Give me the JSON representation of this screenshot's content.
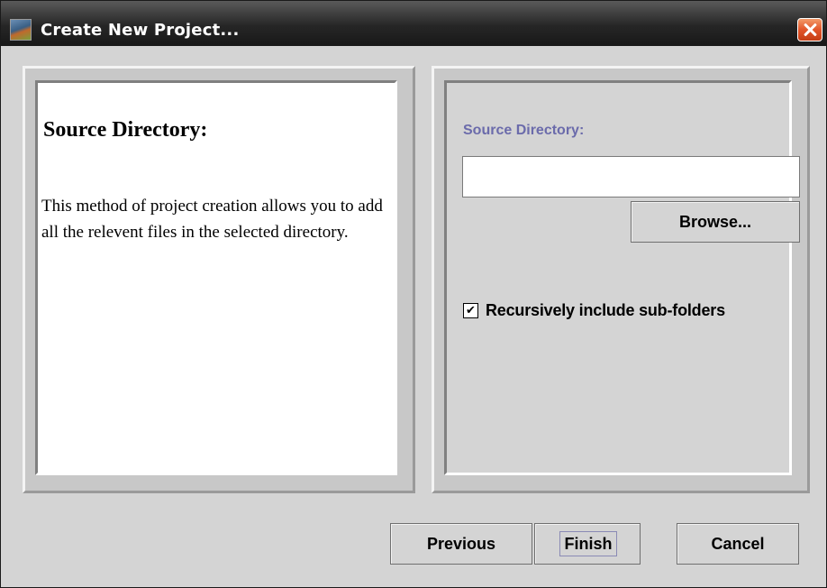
{
  "window": {
    "title": "Create New Project...",
    "app_icon": "app-icon",
    "close_icon": "close-icon"
  },
  "description": {
    "heading": "Source Directory:",
    "body": "This method of project creation allows you to add all the relevent files in the selected directory."
  },
  "form": {
    "source_label": "Source Directory:",
    "source_value": "",
    "browse_label": "Browse...",
    "recursive_checked": true,
    "recursive_mark": "✔",
    "recursive_label": "Recursively include sub-folders"
  },
  "buttons": {
    "previous": "Previous",
    "finish": "Finish",
    "cancel": "Cancel"
  },
  "colors": {
    "label_accent": "#6b6bab",
    "close_button": "#e2552a"
  }
}
